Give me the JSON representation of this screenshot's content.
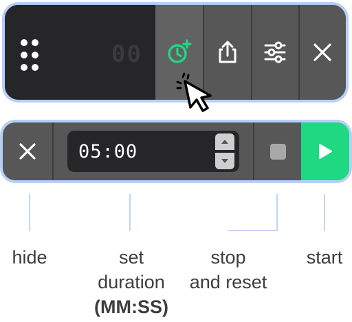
{
  "toolbar": {
    "timer_display": "00",
    "tools": [
      {
        "icon": "timer-add-icon",
        "active": true
      },
      {
        "icon": "share-icon",
        "active": false
      },
      {
        "icon": "sliders-icon",
        "active": false
      },
      {
        "icon": "close-icon",
        "active": false
      }
    ]
  },
  "controls": {
    "duration_value": "05:00",
    "hide_icon": "close-icon",
    "stop_icon": "stop-icon",
    "start_icon": "play-icon"
  },
  "labels": {
    "hide": "hide",
    "set_duration_line1": "set",
    "set_duration_line2": "duration",
    "set_duration_format": "(MM:SS)",
    "stop_line1": "stop",
    "stop_line2": "and reset",
    "start": "start"
  },
  "colors": {
    "accent_green": "#1ed882",
    "bar_outline": "#b7cff6",
    "bar_dark": "#262628",
    "bar_gray": "#575757",
    "label_text": "#3d3d3d"
  }
}
